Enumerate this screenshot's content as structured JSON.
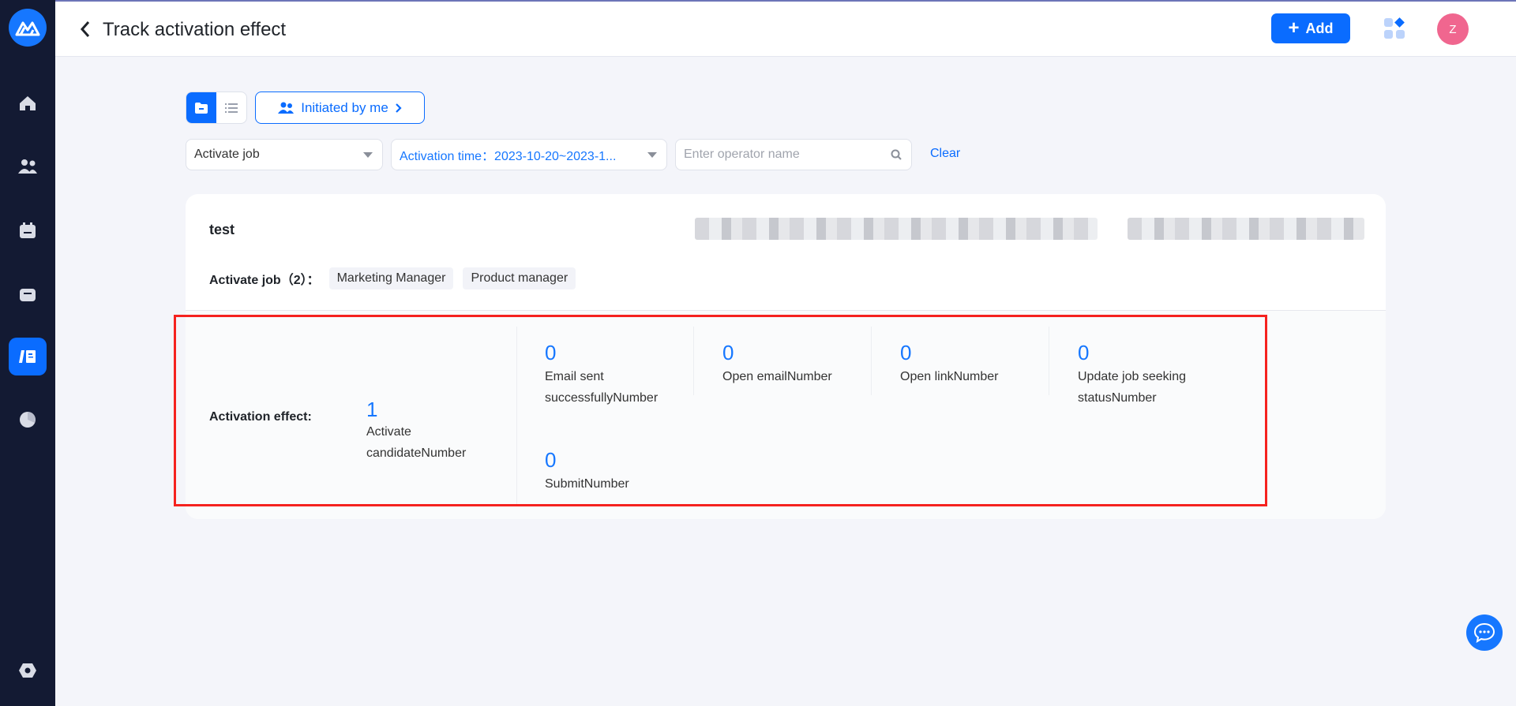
{
  "header": {
    "title": "Track activation effect",
    "add_label": "Add",
    "avatar_initial": "Z"
  },
  "sidebar": {
    "items": [
      "home",
      "candidates",
      "calendar",
      "jobs",
      "activation",
      "reports"
    ],
    "active": "activation"
  },
  "toolbar": {
    "initiated_label": "Initiated by me"
  },
  "filters": {
    "job_select": "Activate job",
    "time_select": "Activation time：2023-10-20~2023-1...",
    "operator_placeholder": "Enter operator name",
    "clear_label": "Clear"
  },
  "card": {
    "name": "test",
    "jobs_label": "Activate job（2）：",
    "jobs": [
      "Marketing Manager",
      "Product manager"
    ],
    "effect_label": "Activation effect:",
    "main_metric": {
      "value": "1",
      "label": "Activate candidateNumber"
    },
    "metrics": [
      {
        "value": "0",
        "label": "Email sent successfullyNumber"
      },
      {
        "value": "0",
        "label": "Open emailNumber"
      },
      {
        "value": "0",
        "label": "Open linkNumber"
      },
      {
        "value": "0",
        "label": "Update job seeking statusNumber"
      },
      {
        "value": "0",
        "label": "SubmitNumber"
      }
    ]
  },
  "colors": {
    "accent": "#0a6cff",
    "sidebar": "#131a33",
    "highlight": "#f5221f",
    "avatar": "#f0668f"
  }
}
